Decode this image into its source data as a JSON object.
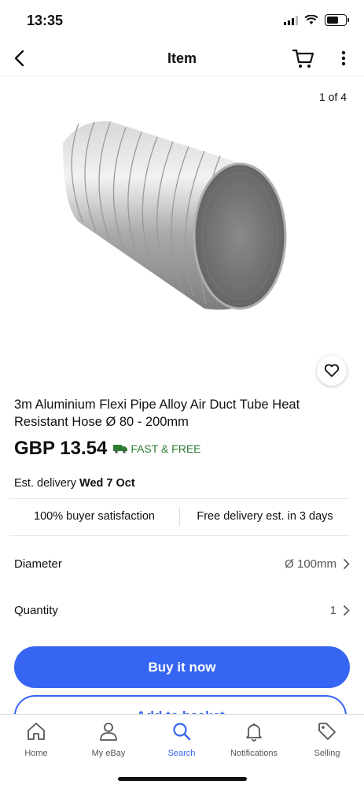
{
  "status": {
    "time": "13:35"
  },
  "nav": {
    "title": "Item"
  },
  "gallery": {
    "counter": "1 of 4"
  },
  "product": {
    "title": "3m Aluminium Flexi Pipe Alloy Air Duct Tube Heat Resistant Hose Ø 80 - 200mm",
    "price": "GBP 13.54",
    "shipping": "FAST & FREE",
    "delivery_label": "Est. delivery",
    "delivery_date": "Wed 7 Oct"
  },
  "badges": {
    "satisfaction": "100% buyer satisfaction",
    "delivery": "Free delivery est. in 3 days"
  },
  "options": {
    "diameter_label": "Diameter",
    "diameter_value": "Ø 100mm",
    "quantity_label": "Quantity",
    "quantity_value": "1"
  },
  "actions": {
    "buy_now": "Buy it now",
    "add_to_basket": "Add to basket"
  },
  "tabs": [
    {
      "label": "Home",
      "icon": "home-icon"
    },
    {
      "label": "My eBay",
      "icon": "user-icon"
    },
    {
      "label": "Search",
      "icon": "search-icon"
    },
    {
      "label": "Notifications",
      "icon": "bell-icon"
    },
    {
      "label": "Selling",
      "icon": "tag-icon"
    }
  ],
  "colors": {
    "accent": "#3665f3",
    "shipping_green": "#2e7d32"
  }
}
